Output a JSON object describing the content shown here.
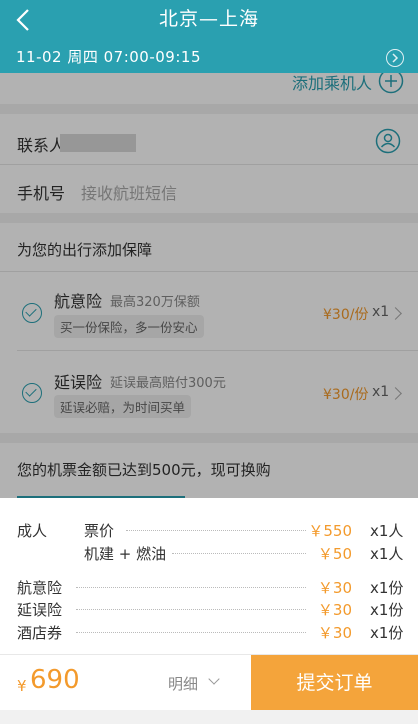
{
  "header": {
    "route": "北京—上海",
    "flight_info": "11-02  周四  07:00-09:15"
  },
  "passenger": {
    "add_label": "添加乘机人"
  },
  "contact": {
    "name_label": "联系人",
    "phone_label": "手机号",
    "phone_placeholder": "接收航班短信"
  },
  "insurance": {
    "section_title": "为您的出行添加保障",
    "items": [
      {
        "title": "航意险",
        "subtitle": "最高320万保额",
        "tag": "买一份保险，多一份安心",
        "price": "¥30/份",
        "qty": "x1"
      },
      {
        "title": "延误险",
        "subtitle": "延误最高赔付300元",
        "tag": "延误必赔，为时间买单",
        "price": "¥30/份",
        "qty": "x1"
      }
    ]
  },
  "promo": {
    "text": "您的机票金额已达到500元，现可换购"
  },
  "price_detail": {
    "adult_label": "成人",
    "rows": [
      {
        "label": "票价",
        "price": "￥550",
        "qty": "x1人"
      },
      {
        "label": "机建 + 燃油",
        "price": "￥50",
        "qty": "x1人"
      },
      {
        "label": "航意险",
        "price": "￥30",
        "qty": "x1份"
      },
      {
        "label": "延误险",
        "price": "￥30",
        "qty": "x1份"
      },
      {
        "label": "酒店券",
        "price": "￥30",
        "qty": "x1份"
      }
    ]
  },
  "bottom_bar": {
    "currency": "¥",
    "total": "690",
    "detail_label": "明细",
    "submit_label": "提交订单"
  },
  "colors": {
    "teal": "#2aa0b0",
    "orange": "#f4a43b",
    "price": "#f39a2c"
  }
}
